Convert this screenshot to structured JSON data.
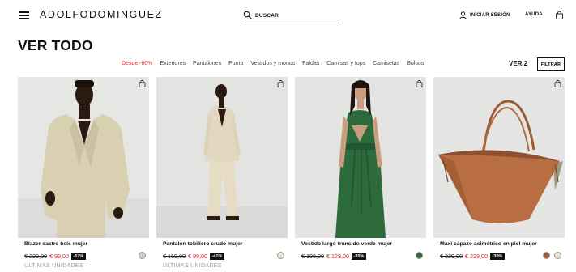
{
  "header": {
    "logo": "ADOLFODOMINGUEZ",
    "search_placeholder": "BUSCAR",
    "login_label": "INICIAR SESIÓN",
    "help_label": "AYUDA",
    "icons": {
      "menu": "hamburger-icon",
      "search": "search-icon",
      "user": "user-icon",
      "bag": "shopping-bag-icon"
    }
  },
  "page": {
    "title": "VER TODO"
  },
  "filters": {
    "categories": [
      "Desde -60%",
      "Exteriores",
      "Pantalones",
      "Punto",
      "Vestidos y monos",
      "Faldas",
      "Camisas y tops",
      "Camisetas",
      "Bolsos"
    ],
    "sale_color": "#e3222a",
    "view_label": "VER 2",
    "filter_button": "FILTRAR"
  },
  "products": [
    {
      "name": "Blazer sastre beis mujer",
      "old_price": "€ 229,00",
      "new_price": "€ 99,00",
      "discount": "-57%",
      "swatch": "#cfcbb5",
      "status": "ÚLTIMAS UNIDADES"
    },
    {
      "name": "Pantalón tobillero crudo mujer",
      "old_price": "€ 169,00",
      "new_price": "€ 99,00",
      "discount": "-41%",
      "swatch": "#e8e1d0",
      "status": "ÚLTIMAS UNIDADES"
    },
    {
      "name": "Vestido largo fruncido verde mujer",
      "old_price": "€ 199,00",
      "new_price": "€ 129,00",
      "discount": "-35%",
      "swatch": "#2f6b3e",
      "status": ""
    },
    {
      "name": "Maxi capazo asimétrico en piel mujer",
      "old_price": "€ 329,00",
      "new_price": "€ 229,00",
      "discount": "-30%",
      "swatch": "#9a5a3a",
      "swatch_alt": "#f0dcc8",
      "status": ""
    }
  ]
}
